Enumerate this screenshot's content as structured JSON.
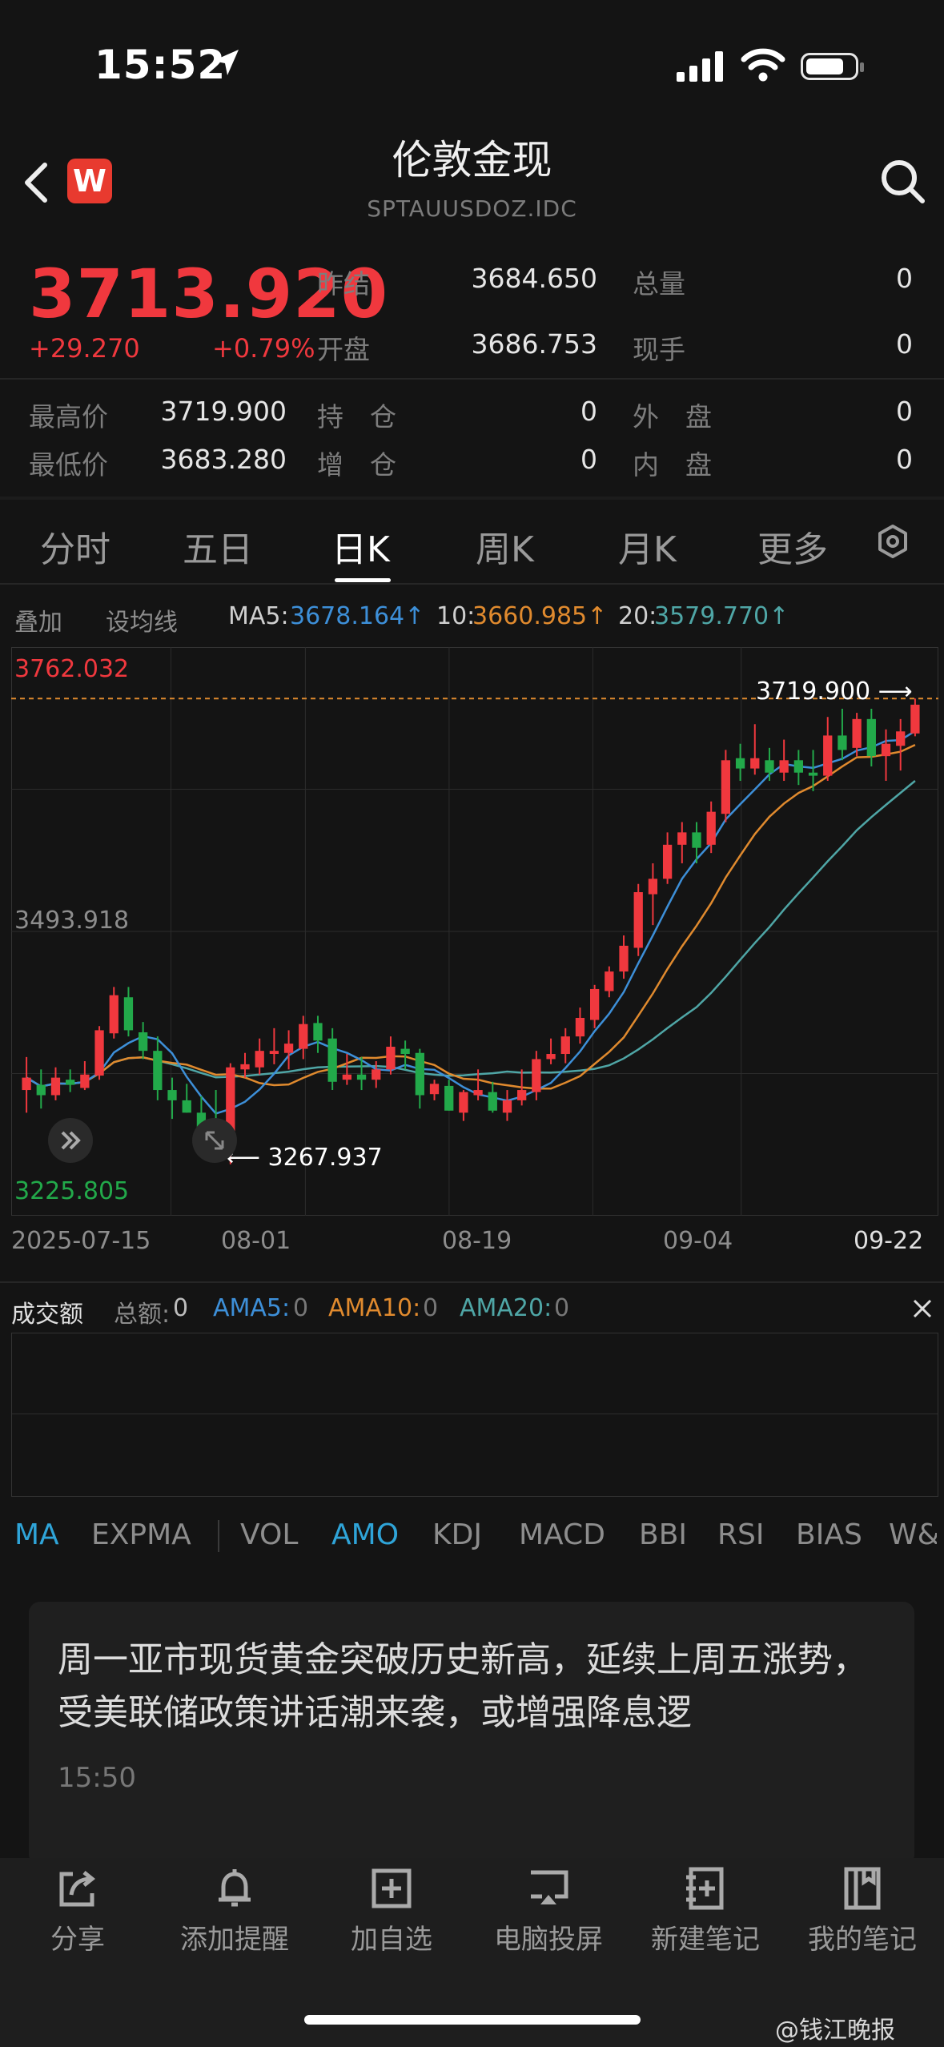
{
  "status": {
    "time": "15:52"
  },
  "header": {
    "title": "伦敦金现",
    "subtitle": "SPTAUUSDOZ.IDC",
    "logo_text": "W"
  },
  "quote": {
    "price": "3713.920",
    "change": "+29.270",
    "change_pct": "+0.79%",
    "prev_close_label": "昨结",
    "prev_close": "3684.650",
    "open_label": "开盘",
    "open": "3686.753",
    "volume_label": "总量",
    "volume": "0",
    "hand_label": "现手",
    "hand": "0",
    "high_label": "最高价",
    "high": "3719.900",
    "low_label": "最低价",
    "low": "3683.280",
    "hold_label": "持　仓",
    "hold": "0",
    "add_label": "增　仓",
    "add": "0",
    "outer_label": "外　盘",
    "outer": "0",
    "inner_label": "内　盘",
    "inner": "0"
  },
  "tabs": [
    "分时",
    "五日",
    "日K",
    "周K",
    "月K",
    "更多"
  ],
  "active_tab": "日K",
  "subbar": {
    "overlay": "叠加",
    "set_ma": "设均线",
    "ma5_label": "MA5:",
    "ma5": "3678.164↑",
    "ma10_label": "10:",
    "ma10": "3660.985↑",
    "ma20_label": "20:",
    "ma20": "3579.770↑"
  },
  "chart_data": {
    "type": "candlestick",
    "y_top_label": "3762.032",
    "y_mid_label": "3493.918",
    "y_bottom_label": "3225.805",
    "ylim": [
      3225.805,
      3762.032
    ],
    "max_marker": "3719.900 ⟶",
    "min_marker": "⟵ 3267.937",
    "x_ticks": [
      "2025-07-15",
      "08-01",
      "08-19",
      "09-04",
      "09-22"
    ],
    "candles": [
      {
        "o": 3340,
        "h": 3372,
        "l": 3318,
        "c": 3352
      },
      {
        "o": 3345,
        "h": 3360,
        "l": 3322,
        "c": 3335
      },
      {
        "o": 3335,
        "h": 3362,
        "l": 3330,
        "c": 3352
      },
      {
        "o": 3350,
        "h": 3360,
        "l": 3338,
        "c": 3345
      },
      {
        "o": 3342,
        "h": 3368,
        "l": 3340,
        "c": 3355
      },
      {
        "o": 3354,
        "h": 3402,
        "l": 3350,
        "c": 3398
      },
      {
        "o": 3395,
        "h": 3440,
        "l": 3390,
        "c": 3432
      },
      {
        "o": 3430,
        "h": 3440,
        "l": 3392,
        "c": 3398
      },
      {
        "o": 3396,
        "h": 3406,
        "l": 3370,
        "c": 3378
      },
      {
        "o": 3378,
        "h": 3392,
        "l": 3330,
        "c": 3340
      },
      {
        "o": 3340,
        "h": 3352,
        "l": 3312,
        "c": 3330
      },
      {
        "o": 3330,
        "h": 3346,
        "l": 3318,
        "c": 3318
      },
      {
        "o": 3318,
        "h": 3334,
        "l": 3300,
        "c": 3302
      },
      {
        "o": 3300,
        "h": 3340,
        "l": 3276,
        "c": 3296
      },
      {
        "o": 3290,
        "h": 3366,
        "l": 3268,
        "c": 3362
      },
      {
        "o": 3360,
        "h": 3376,
        "l": 3352,
        "c": 3365
      },
      {
        "o": 3362,
        "h": 3390,
        "l": 3355,
        "c": 3378
      },
      {
        "o": 3375,
        "h": 3400,
        "l": 3365,
        "c": 3378
      },
      {
        "o": 3376,
        "h": 3398,
        "l": 3360,
        "c": 3385
      },
      {
        "o": 3380,
        "h": 3412,
        "l": 3370,
        "c": 3404
      },
      {
        "o": 3405,
        "h": 3412,
        "l": 3376,
        "c": 3388
      },
      {
        "o": 3390,
        "h": 3400,
        "l": 3340,
        "c": 3348
      },
      {
        "o": 3350,
        "h": 3375,
        "l": 3345,
        "c": 3355
      },
      {
        "o": 3355,
        "h": 3372,
        "l": 3340,
        "c": 3350
      },
      {
        "o": 3350,
        "h": 3368,
        "l": 3342,
        "c": 3360
      },
      {
        "o": 3360,
        "h": 3392,
        "l": 3355,
        "c": 3382
      },
      {
        "o": 3380,
        "h": 3388,
        "l": 3360,
        "c": 3375
      },
      {
        "o": 3376,
        "h": 3380,
        "l": 3322,
        "c": 3335
      },
      {
        "o": 3336,
        "h": 3350,
        "l": 3330,
        "c": 3346
      },
      {
        "o": 3344,
        "h": 3350,
        "l": 3320,
        "c": 3320
      },
      {
        "o": 3318,
        "h": 3340,
        "l": 3310,
        "c": 3338
      },
      {
        "o": 3335,
        "h": 3360,
        "l": 3330,
        "c": 3340
      },
      {
        "o": 3338,
        "h": 3348,
        "l": 3318,
        "c": 3320
      },
      {
        "o": 3318,
        "h": 3340,
        "l": 3310,
        "c": 3330
      },
      {
        "o": 3330,
        "h": 3360,
        "l": 3325,
        "c": 3340
      },
      {
        "o": 3338,
        "h": 3378,
        "l": 3330,
        "c": 3370
      },
      {
        "o": 3370,
        "h": 3390,
        "l": 3365,
        "c": 3375
      },
      {
        "o": 3375,
        "h": 3400,
        "l": 3366,
        "c": 3392
      },
      {
        "o": 3392,
        "h": 3420,
        "l": 3385,
        "c": 3410
      },
      {
        "o": 3408,
        "h": 3442,
        "l": 3400,
        "c": 3438
      },
      {
        "o": 3436,
        "h": 3460,
        "l": 3430,
        "c": 3455
      },
      {
        "o": 3455,
        "h": 3490,
        "l": 3448,
        "c": 3480
      },
      {
        "o": 3478,
        "h": 3540,
        "l": 3470,
        "c": 3532
      },
      {
        "o": 3530,
        "h": 3560,
        "l": 3500,
        "c": 3545
      },
      {
        "o": 3545,
        "h": 3590,
        "l": 3540,
        "c": 3578
      },
      {
        "o": 3578,
        "h": 3600,
        "l": 3560,
        "c": 3590
      },
      {
        "o": 3590,
        "h": 3600,
        "l": 3560,
        "c": 3575
      },
      {
        "o": 3578,
        "h": 3620,
        "l": 3570,
        "c": 3610
      },
      {
        "o": 3608,
        "h": 3670,
        "l": 3600,
        "c": 3660
      },
      {
        "o": 3662,
        "h": 3676,
        "l": 3640,
        "c": 3652
      },
      {
        "o": 3652,
        "h": 3695,
        "l": 3646,
        "c": 3662
      },
      {
        "o": 3660,
        "h": 3672,
        "l": 3640,
        "c": 3648
      },
      {
        "o": 3648,
        "h": 3680,
        "l": 3640,
        "c": 3660
      },
      {
        "o": 3660,
        "h": 3670,
        "l": 3636,
        "c": 3648
      },
      {
        "o": 3648,
        "h": 3670,
        "l": 3630,
        "c": 3645
      },
      {
        "o": 3645,
        "h": 3702,
        "l": 3640,
        "c": 3684
      },
      {
        "o": 3684,
        "h": 3710,
        "l": 3660,
        "c": 3670
      },
      {
        "o": 3672,
        "h": 3706,
        "l": 3664,
        "c": 3700
      },
      {
        "o": 3700,
        "h": 3710,
        "l": 3654,
        "c": 3664
      },
      {
        "o": 3664,
        "h": 3690,
        "l": 3640,
        "c": 3676
      },
      {
        "o": 3674,
        "h": 3700,
        "l": 3650,
        "c": 3688
      },
      {
        "o": 3686,
        "h": 3719.9,
        "l": 3683.28,
        "c": 3713.92
      }
    ]
  },
  "volume": {
    "title": "成交额",
    "total_label": "总额:",
    "total": "0",
    "ama5_label": "AMA5:",
    "ama5": "0",
    "ama10_label": "AMA10:",
    "ama10": "0",
    "ama20_label": "AMA20:",
    "ama20": "0"
  },
  "indicators": [
    "MA",
    "EXPMA",
    "VOL",
    "AMO",
    "KDJ",
    "MACD",
    "BBI",
    "RSI",
    "BIAS",
    "W&"
  ],
  "news": {
    "text": "周一亚市现货黄金突破历史新高，延续上周五涨势，受美联储政策讲话潮来袭，或增强降息逻",
    "time": "15:50"
  },
  "bottom": [
    "分享",
    "添加提醒",
    "加自选",
    "电脑投屏",
    "新建笔记",
    "我的笔记"
  ],
  "watermark": "@钱江晚报",
  "colors": {
    "up": "#f0383e",
    "down": "#22a94a",
    "ma5": "#3d8fd8",
    "ma10": "#e08a2e",
    "ma20": "#4fa6a6"
  }
}
